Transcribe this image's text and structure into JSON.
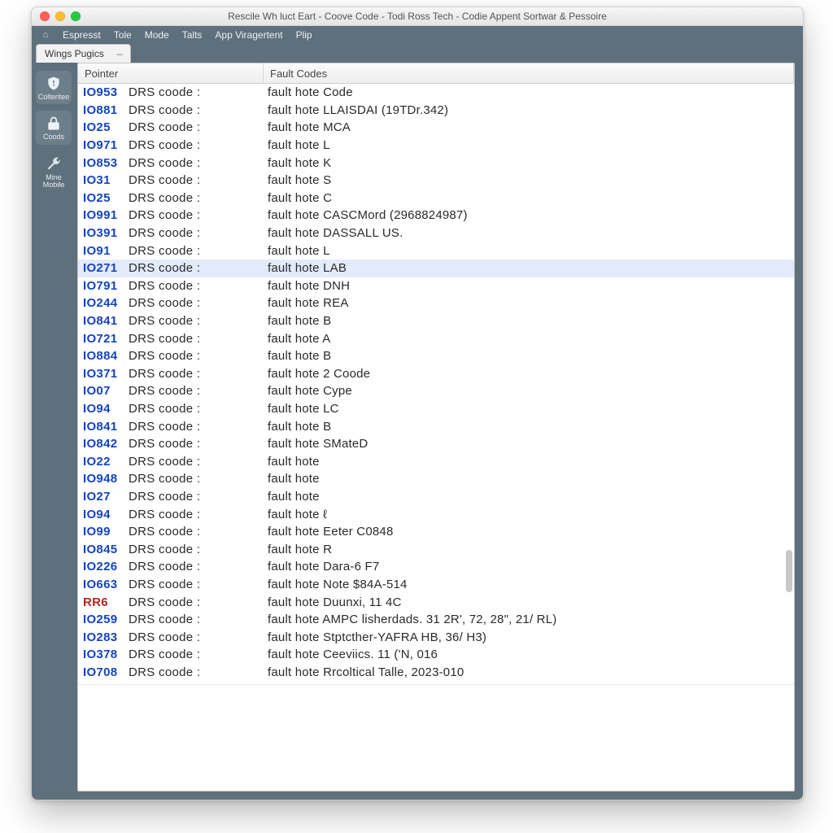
{
  "window": {
    "title": "Rescile Wh luct Eart - Coove Code - Todi Ross Tech - Codie Appent Sortwar & Pessoire"
  },
  "menu": [
    "Espresst",
    "Tole",
    "Mode",
    "Talts",
    "App Viragertent",
    "Plip"
  ],
  "tabs": [
    {
      "label": "Wings Pugics"
    }
  ],
  "sidebar": [
    {
      "label": "Colteritee"
    },
    {
      "label": "Coods"
    },
    {
      "label": "Mine Mobile"
    }
  ],
  "columns": [
    "Pointer",
    "Fault Codes"
  ],
  "drs_label": "DRS  coode :",
  "fault_prefix": "fault hote",
  "selected_index": 10,
  "rows": [
    {
      "id": "IO953",
      "fault": "Code"
    },
    {
      "id": "IO881",
      "fault": "LLAISDAI (19TDr.342)"
    },
    {
      "id": "IO25",
      "fault": "MCA"
    },
    {
      "id": "IO971",
      "fault": "L"
    },
    {
      "id": "IO853",
      "fault": "K"
    },
    {
      "id": "IO31",
      "fault": "S"
    },
    {
      "id": "IO25",
      "fault": "C"
    },
    {
      "id": "IO991",
      "fault": "CASCMord (2968824987)"
    },
    {
      "id": "IO391",
      "fault": "DASSALL US."
    },
    {
      "id": "IO91",
      "fault": "L"
    },
    {
      "id": "IO271",
      "fault": "LAB"
    },
    {
      "id": "IO791",
      "fault": "DNH"
    },
    {
      "id": "IO244",
      "fault": "REA"
    },
    {
      "id": "IO841",
      "fault": "B"
    },
    {
      "id": "IO721",
      "fault": "A"
    },
    {
      "id": "IO884",
      "fault": "B"
    },
    {
      "id": "IO371",
      "fault": "2 Coode"
    },
    {
      "id": "IO07",
      "fault": "Cype"
    },
    {
      "id": "IO94",
      "fault": "LC"
    },
    {
      "id": "IO841",
      "fault": "B"
    },
    {
      "id": "IO842",
      "fault": "SMateD"
    },
    {
      "id": "IO22",
      "fault": ""
    },
    {
      "id": "IO948",
      "fault": ""
    },
    {
      "id": "IO27",
      "fault": ""
    },
    {
      "id": "IO94",
      "fault": "ℓ"
    },
    {
      "id": "IO99",
      "fault": "Eeter C0848"
    },
    {
      "id": "IO845",
      "fault": "R"
    },
    {
      "id": "IO226",
      "fault": "Dara-6 F7"
    },
    {
      "id": "IO663",
      "fault": "Note $84A-514"
    },
    {
      "id": "RR6",
      "fault": "Duunxi, 11 4C",
      "alt": true
    },
    {
      "id": "IO259",
      "fault": "AMPC lisherdads.  31 2R', 72, 28\", 21/ RL)"
    },
    {
      "id": "IO283",
      "fault": "Stptcther-YAFRA HB, 36/ H3)"
    },
    {
      "id": "IO378",
      "fault": "Ceeviics. 11 ('N, 016"
    },
    {
      "id": "IO708",
      "fault": "Rrcoltical Talle,  2023-010"
    }
  ]
}
